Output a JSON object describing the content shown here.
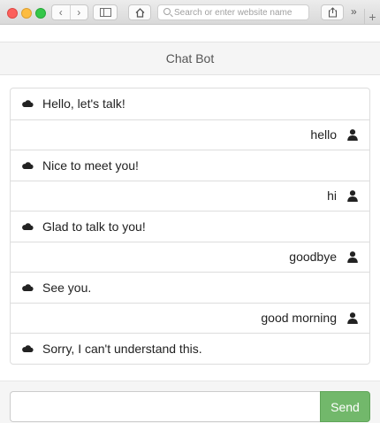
{
  "browser": {
    "address_placeholder": "Search or enter website name"
  },
  "header": {
    "title": "Chat Bot"
  },
  "messages": [
    {
      "sender": "bot",
      "text": "Hello, let's talk!"
    },
    {
      "sender": "user",
      "text": "hello"
    },
    {
      "sender": "bot",
      "text": "Nice to meet you!"
    },
    {
      "sender": "user",
      "text": "hi"
    },
    {
      "sender": "bot",
      "text": "Glad to talk to you!"
    },
    {
      "sender": "user",
      "text": "goodbye"
    },
    {
      "sender": "bot",
      "text": "See you."
    },
    {
      "sender": "user",
      "text": "good morning"
    },
    {
      "sender": "bot",
      "text": "Sorry, I can't understand this."
    }
  ],
  "composer": {
    "input_value": "",
    "send_label": "Send"
  },
  "colors": {
    "send_button": "#72b86b"
  },
  "icons": {
    "bot": "cloud-icon",
    "user": "user-icon"
  }
}
